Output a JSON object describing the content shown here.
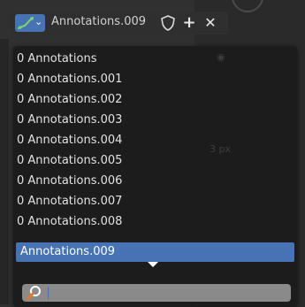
{
  "header": {
    "type_icon": "annotate-grease-pencil-icon",
    "chevron_icon": "chevron-down-icon",
    "name": "Annotations.009",
    "fake_user_icon": "shield-icon",
    "add_icon": "plus-icon",
    "remove_icon": "x-icon"
  },
  "menu": {
    "items": [
      {
        "label": "0 Annotations"
      },
      {
        "label": "0 Annotations.001"
      },
      {
        "label": "0 Annotations.002"
      },
      {
        "label": "0 Annotations.003"
      },
      {
        "label": "0 Annotations.004"
      },
      {
        "label": "0 Annotations.005"
      },
      {
        "label": "0 Annotations.006"
      },
      {
        "label": "0 Annotations.007"
      },
      {
        "label": "0 Annotations.008"
      },
      {
        "label": "Annotations.009"
      }
    ],
    "selected_index": 9,
    "search_icon": "magnifier-icon",
    "search_value": ""
  },
  "colors": {
    "accent": "#4772b3",
    "menu_bg": "#1c1c1c",
    "text": "#e2e2e2",
    "search_bg": "#8a8a8a"
  }
}
